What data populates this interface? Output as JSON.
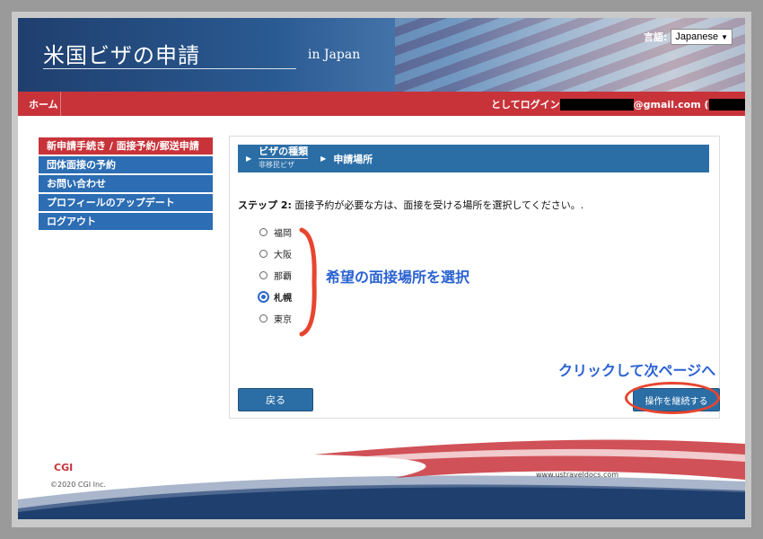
{
  "header": {
    "title": "米国ビザの申請",
    "subtitle": "in Japan",
    "language_label": "言語:",
    "language_value": "Japanese"
  },
  "navbar": {
    "home": "ホーム",
    "login_prefix": "としてログイン",
    "login_email_suffix": "@gmail.com (",
    "login_close": ")"
  },
  "sidebar": {
    "items": [
      {
        "label": "新申請手続き / 面接予約/郵送申請",
        "active": true
      },
      {
        "label": "団体面接の予約",
        "active": false
      },
      {
        "label": "お問い合わせ",
        "active": false
      },
      {
        "label": "プロフィールのアップデート",
        "active": false
      },
      {
        "label": "ログアウト",
        "active": false
      }
    ]
  },
  "breadcrumb": {
    "step1": "ビザの種類",
    "step1_sub": "非移民ビザ",
    "step2": "申請場所"
  },
  "main": {
    "step_label": "ステップ 2:",
    "step_text": " 面接予約が必要な方は、面接を受ける場所を選択してください。.",
    "options": [
      {
        "label": "福岡",
        "checked": false
      },
      {
        "label": "大阪",
        "checked": false
      },
      {
        "label": "那覇",
        "checked": false
      },
      {
        "label": "札幌",
        "checked": true
      },
      {
        "label": "東京",
        "checked": false
      }
    ],
    "back_button": "戻る",
    "continue_button": "操作を継続する"
  },
  "annotations": {
    "select_location": "希望の面接場所を選択",
    "click_next": "クリックして次ページへ"
  },
  "footer": {
    "logo": "CGI",
    "copyright": "©2020 CGI Inc.",
    "url": "www.ustraveldocs.com"
  },
  "colors": {
    "header_blue": "#1f3f6e",
    "nav_red": "#c8333a",
    "sidebar_blue": "#2c6db3",
    "button_blue": "#2b6ea6",
    "annotation_blue": "#2a62d3",
    "annotation_red": "#e8452f"
  }
}
